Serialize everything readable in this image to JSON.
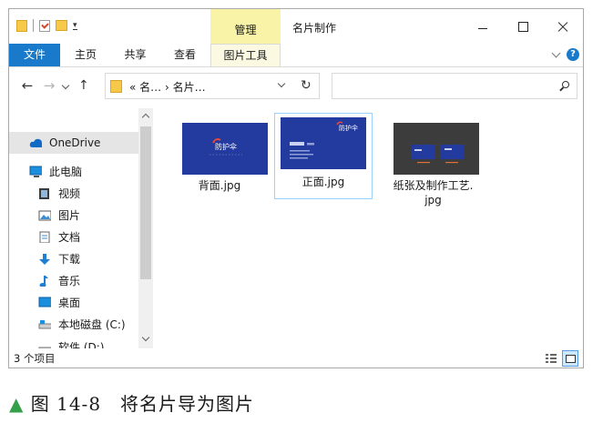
{
  "window": {
    "title": "名片制作",
    "context_tab_group": "管理"
  },
  "ribbon": {
    "tabs": [
      "文件",
      "主页",
      "共享",
      "查看",
      "图片工具"
    ],
    "help_glyph": "?"
  },
  "nav": {
    "back_glyph": "←",
    "forward_glyph": "→",
    "up_glyph": "↑",
    "address": "« 名… › 名片…",
    "refresh_glyph": "↻",
    "search_placeholder": ""
  },
  "sidebar": {
    "items": [
      {
        "label": "OneDrive",
        "icon": "onedrive-icon",
        "selected": true
      },
      {
        "label": "此电脑",
        "icon": "this-pc-icon"
      },
      {
        "label": "视频",
        "icon": "videos-icon"
      },
      {
        "label": "图片",
        "icon": "pictures-icon"
      },
      {
        "label": "文档",
        "icon": "documents-icon"
      },
      {
        "label": "下载",
        "icon": "downloads-icon"
      },
      {
        "label": "音乐",
        "icon": "music-icon"
      },
      {
        "label": "桌面",
        "icon": "desktop-icon"
      },
      {
        "label": "本地磁盘 (C:)",
        "icon": "local-disk-icon"
      },
      {
        "label": "软件 (D:)",
        "icon": "drive-d-icon"
      }
    ]
  },
  "files": [
    {
      "name": "背面.jpg",
      "selected": false,
      "thumb_text": "防护伞",
      "theme_color": "#233a9e"
    },
    {
      "name": "正面.jpg",
      "selected": true,
      "thumb_text": "防护伞",
      "theme_color": "#233a9e"
    },
    {
      "name": "纸张及制作工艺.jpg",
      "name_line1": "纸张及制作工艺.",
      "name_line2": "jpg",
      "selected": false,
      "theme_color": "#3c3c3c"
    }
  ],
  "status": {
    "item_count": "3 个项目"
  },
  "caption": {
    "marker": "▲",
    "text": "图 14-8　将名片导为图片"
  },
  "colors": {
    "accent": "#1979ca",
    "context_tab": "#f8f3a7",
    "selection": "#cce8ff"
  }
}
